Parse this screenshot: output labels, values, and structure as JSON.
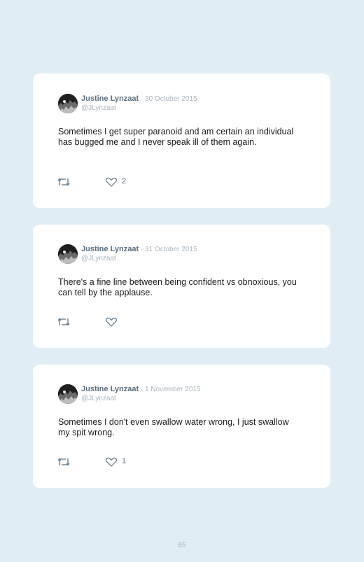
{
  "tweets": [
    {
      "name": "Justine Lynzaat",
      "separator": " · ",
      "date": "30 October 2015",
      "handle": "@JLynzaat",
      "text": "Sometimes I get super paranoid and am certain an individual has bugged me and I never speak ill of them again.",
      "likes": "2"
    },
    {
      "name": "Justine Lynzaat",
      "separator": " · ",
      "date": "31 October 2015",
      "handle": "@JLynzaat",
      "text": "There's a fine line between being confident vs obnoxious, you can tell by the applause.",
      "likes": ""
    },
    {
      "name": "Justine Lynzaat",
      "separator": " · ",
      "date": "1 November 2015",
      "handle": "@JLynzaat",
      "text": "Sometimes I don't even swallow water wrong, I just swallow my spit wrong.",
      "likes": "1"
    }
  ],
  "icons": {
    "avatar": "avatar-photo",
    "retweet": "retweet-icon",
    "like": "heart-icon"
  },
  "colors": {
    "background": "#e0edf5",
    "card": "#ffffff",
    "name": "#5b6f80",
    "meta": "#a8b4be",
    "icon": "#5b7385"
  },
  "page_number": "65"
}
